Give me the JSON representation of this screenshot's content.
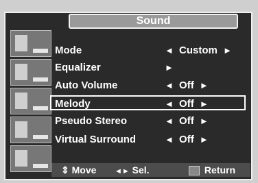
{
  "menu": {
    "title": "Sound",
    "items": [
      {
        "label": "Mode",
        "value": "Custom",
        "left_arrow": "◄",
        "right_arrow": "►"
      },
      {
        "label": "Equalizer",
        "value": "",
        "left_arrow": "",
        "right_arrow": "►"
      },
      {
        "label": "Auto Volume",
        "value": "Off",
        "left_arrow": "◄",
        "right_arrow": "►"
      },
      {
        "label": "Melody",
        "value": "Off",
        "left_arrow": "◄",
        "right_arrow": "►"
      },
      {
        "label": "Pseudo Stereo",
        "value": "Off",
        "left_arrow": "◄",
        "right_arrow": "►"
      },
      {
        "label": "Virtual Surround",
        "value": "Off",
        "left_arrow": "◄",
        "right_arrow": "►"
      }
    ],
    "selected_item": "Melody"
  },
  "sidebar": {
    "icons": [
      "picture-icon",
      "sound-icon",
      "setup-icon",
      "channel-icon",
      "pip-icon"
    ]
  },
  "footer": {
    "move_icon": "⇕",
    "move_label": "Move",
    "sel_icon": "◄►",
    "sel_label": "Sel.",
    "return_icon": "III",
    "return_label": "Return"
  }
}
